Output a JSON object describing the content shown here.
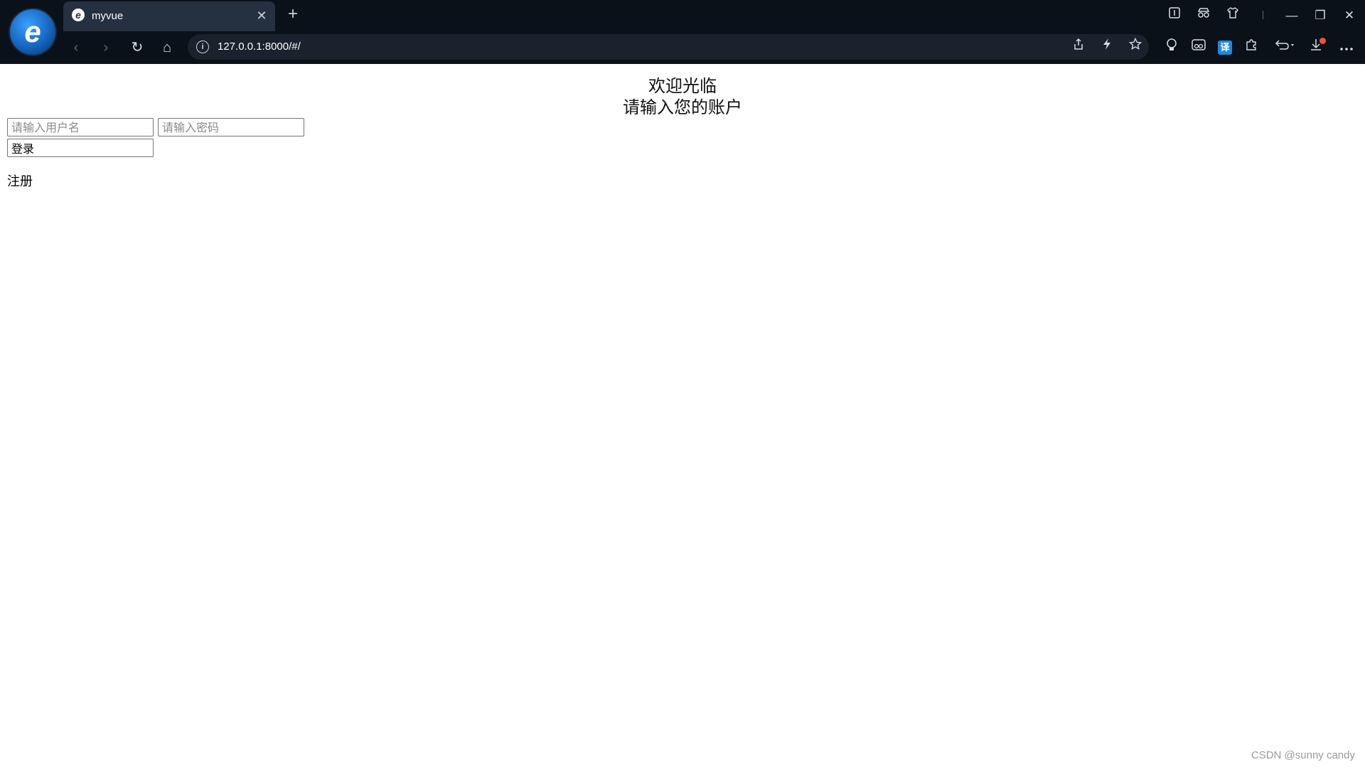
{
  "browser": {
    "logo_glyph": "e",
    "tab": {
      "favicon_glyph": "e",
      "title": "myvue",
      "close_glyph": "✕"
    },
    "new_tab_glyph": "+",
    "address": {
      "url": "127.0.0.1:8000/#/",
      "info_glyph": "i"
    },
    "window_controls": {
      "minimize": "—",
      "restore": "❐",
      "close": "✕"
    },
    "nav_glyphs": {
      "back": "‹",
      "forward": "›",
      "reload": "↻",
      "home": "⌂"
    },
    "extension_glyphs": {
      "translate": "译"
    },
    "icons": [
      "tab-actions-icon",
      "incognito-icon",
      "shirt-icon",
      "share-icon",
      "bolt-icon",
      "star-icon",
      "bulb-icon",
      "reader-icon",
      "translate-icon",
      "puzzle-icon",
      "undo-icon",
      "download-icon",
      "more-icon"
    ],
    "theme": {
      "chrome": "#0b1119",
      "tab_active": "#253040",
      "omnibox": "#1a222d"
    }
  },
  "page": {
    "welcome": "欢迎光临",
    "prompt": "请输入您的账户",
    "username_placeholder": "请输入用户名",
    "password_placeholder": "请输入密码",
    "login_label": "登录",
    "register_label": "注册"
  },
  "watermark": "CSDN @sunny candy"
}
